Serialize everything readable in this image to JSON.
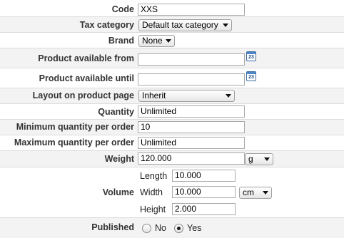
{
  "fields": {
    "code": {
      "label": "Code",
      "value": "XXS"
    },
    "tax_category": {
      "label": "Tax category",
      "value": "Default tax category"
    },
    "brand": {
      "label": "Brand",
      "value": "None"
    },
    "available_from": {
      "label": "Product available from",
      "value": "",
      "calendar": "23"
    },
    "available_until": {
      "label": "Product available until",
      "value": "",
      "calendar": "23"
    },
    "layout": {
      "label": "Layout on product page",
      "value": "Inherit"
    },
    "quantity": {
      "label": "Quantity",
      "value": "Unlimited"
    },
    "min_qty": {
      "label": "Minimum quantity per order",
      "value": "10"
    },
    "max_qty": {
      "label": "Maximum quantity per order",
      "value": "Unlimited"
    },
    "weight": {
      "label": "Weight",
      "value": "120.000",
      "unit": "g"
    },
    "volume": {
      "label": "Volume",
      "length_label": "Length",
      "length": "10.000",
      "width_label": "Width",
      "width": "10.000",
      "height_label": "Height",
      "height": "2.000",
      "unit": "cm"
    },
    "published": {
      "label": "Published",
      "no": "No",
      "yes": "Yes",
      "selected": "Yes"
    }
  }
}
